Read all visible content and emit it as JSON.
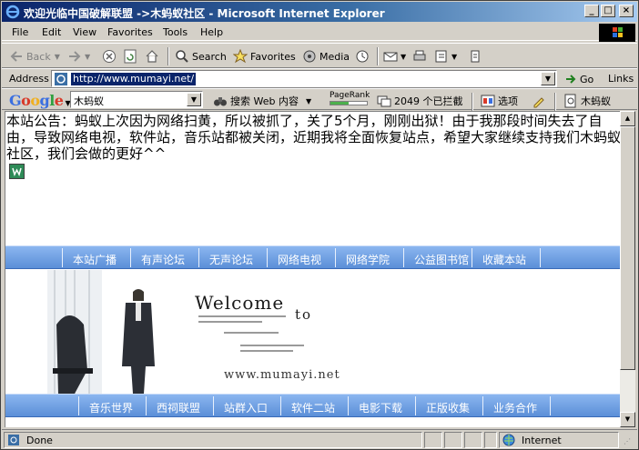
{
  "window": {
    "title": "欢迎光临中国破解联盟 ->木蚂蚁社区 - Microsoft Internet Explorer",
    "controls": [
      "_",
      "□",
      "×"
    ]
  },
  "menu": {
    "items": [
      {
        "label": "File",
        "accel": "F"
      },
      {
        "label": "Edit",
        "accel": "E"
      },
      {
        "label": "View",
        "accel": "V"
      },
      {
        "label": "Favorites",
        "accel": "a"
      },
      {
        "label": "Tools",
        "accel": "T"
      },
      {
        "label": "Help",
        "accel": "H"
      }
    ]
  },
  "toolbar": {
    "back_label": "Back",
    "search_label": "Search",
    "favorites_label": "Favorites",
    "media_label": "Media",
    "icons": [
      "back-arrow-icon",
      "forward-arrow-icon",
      "stop-icon",
      "refresh-icon",
      "home-icon",
      "search-icon",
      "favorites-star-icon",
      "media-icon",
      "history-icon",
      "mail-icon",
      "print-icon",
      "edit-icon",
      "discuss-icon"
    ]
  },
  "address": {
    "label": "Address",
    "url": "http://www.mumayi.net/",
    "go_label": "Go",
    "links_label": "Links"
  },
  "google_bar": {
    "logo": "Google",
    "query": "木蚂蚁",
    "search_web_label": "搜索 Web 内容",
    "pagerank_label": "PageRank",
    "pagerank_level": 0.5,
    "blocked_label": "2049 个已拦截",
    "options_label": "选项",
    "highlight_term": "木蚂蚁"
  },
  "page": {
    "notice": "本站公告：蚂蚁上次因为网络扫黄，所以被抓了，关了5个月，刚刚出狱！由于我那段时间失去了自由，导致网络电视，软件站，音乐站都被关闭，近期我将全面恢复站点，希望大家继续支持我们木蚂蚁社区，我们会做的更好^^",
    "nav_top": [
      "本站广播",
      "有声论坛",
      "无声论坛",
      "网络电视",
      "网络学院",
      "公益图书馆",
      "收藏本站"
    ],
    "banner_welcome": "Welcome",
    "banner_to": "to",
    "banner_site": "www.mumayi.net",
    "nav_bottom": [
      "音乐世界",
      "西祠联盟",
      "站群入口",
      "软件二站",
      "电影下载",
      "正版收集",
      "业务合作"
    ]
  },
  "status": {
    "text": "Done",
    "zone": "Internet"
  },
  "colors": {
    "title_bar": "#0a246a",
    "nav_bar": "#6b9ee0",
    "selection": "#0a246a"
  }
}
